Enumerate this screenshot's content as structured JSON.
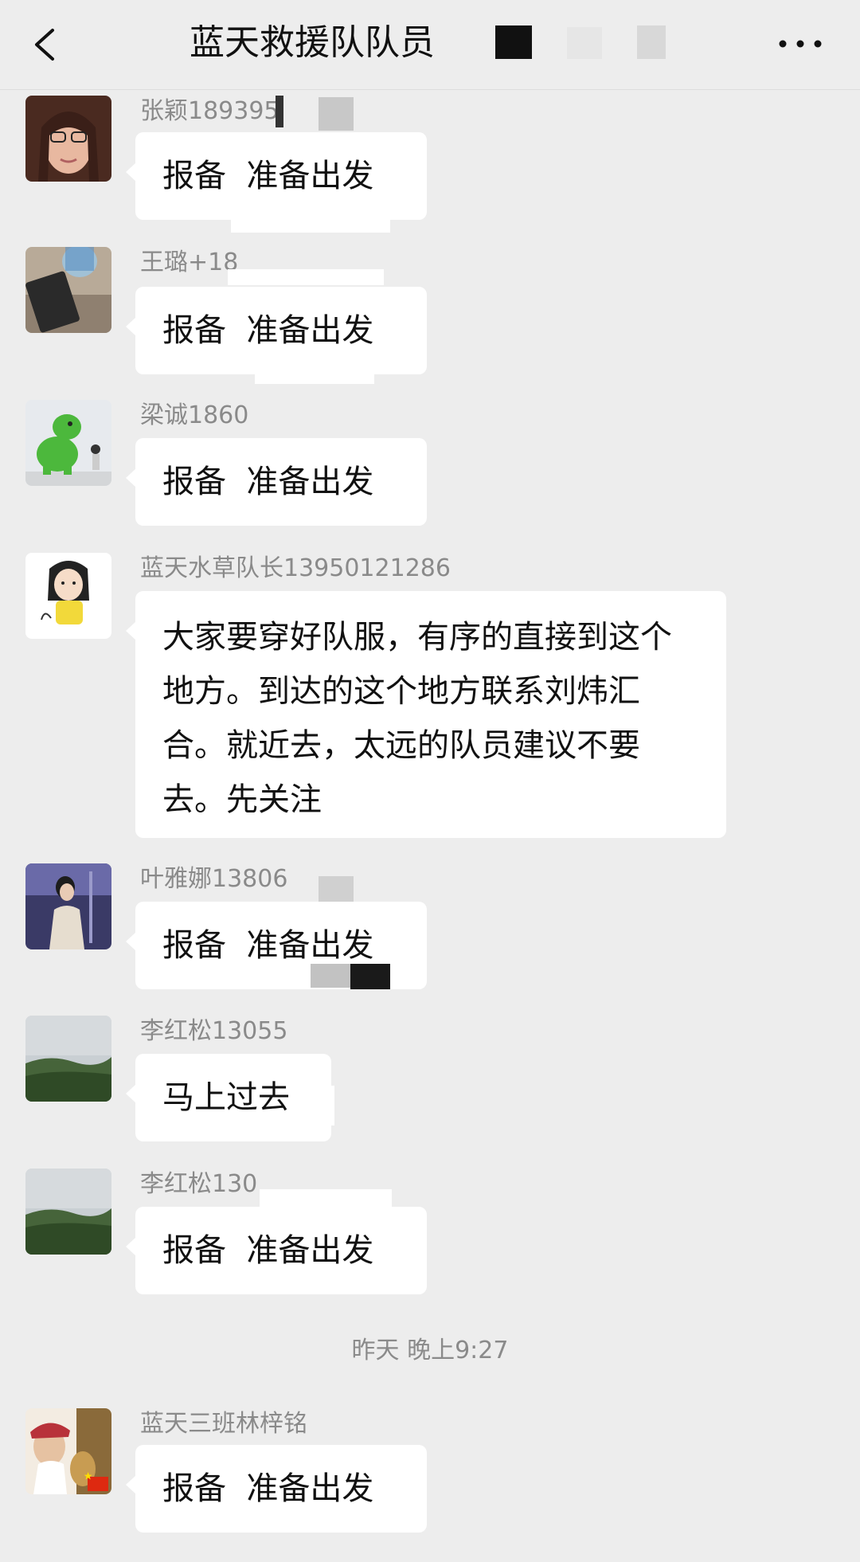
{
  "header": {
    "title": "蓝天救援队队员",
    "back_icon": "back-chevron-icon",
    "more_icon": "more-dots-icon"
  },
  "messages": [
    {
      "sender": "张颖189395",
      "text": "报备  准备出发"
    },
    {
      "sender": "王璐+18",
      "text": "报备  准备出发"
    },
    {
      "sender": "梁诚1860",
      "text": "报备  准备出发"
    },
    {
      "sender": "蓝天水草队长13950121286",
      "text": "大家要穿好队服，有序的直接到这个地方。到达的这个地方联系刘炜汇合。就近去，太远的队员建议不要去。先关注"
    },
    {
      "sender": "叶雅娜13806",
      "text": "报备  准备出发"
    },
    {
      "sender": "李红松13055",
      "text": "马上过去"
    },
    {
      "sender": "李红松130",
      "text": "报备  准备出发"
    },
    {
      "sender": "蓝天三班林梓铭",
      "text": "报备  准备出发"
    }
  ],
  "timestamp": "昨天 晚上9:27",
  "colors": {
    "background": "#ededed",
    "bubble": "#ffffff",
    "sender_text": "#8a8a8a"
  }
}
